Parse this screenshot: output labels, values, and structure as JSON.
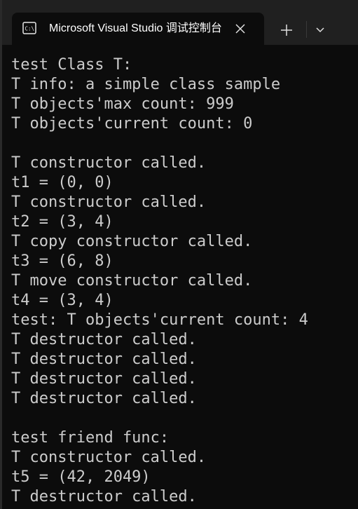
{
  "window": {
    "tab_title": "Microsoft Visual Studio 调试控制台",
    "icons": {
      "tab_icon": "console-icon",
      "close": "close-icon",
      "new_tab": "plus-icon",
      "dropdown": "chevron-down-icon"
    },
    "colors": {
      "titlebar": "#202020",
      "console_bg": "#0c0c0c",
      "console_text": "#cccccc",
      "tab_text": "#ffffff"
    }
  },
  "console": {
    "lines": [
      "test Class T:",
      "T info: a simple class sample",
      "T objects'max count: 999",
      "T objects'current count: 0",
      "",
      "T constructor called.",
      "t1 = (0, 0)",
      "T constructor called.",
      "t2 = (3, 4)",
      "T copy constructor called.",
      "t3 = (6, 8)",
      "T move constructor called.",
      "t4 = (3, 4)",
      "test: T objects'current count: 4",
      "T destructor called.",
      "T destructor called.",
      "T destructor called.",
      "T destructor called.",
      "",
      "test friend func:",
      "T constructor called.",
      "t5 = (42, 2049)",
      "T destructor called."
    ]
  }
}
